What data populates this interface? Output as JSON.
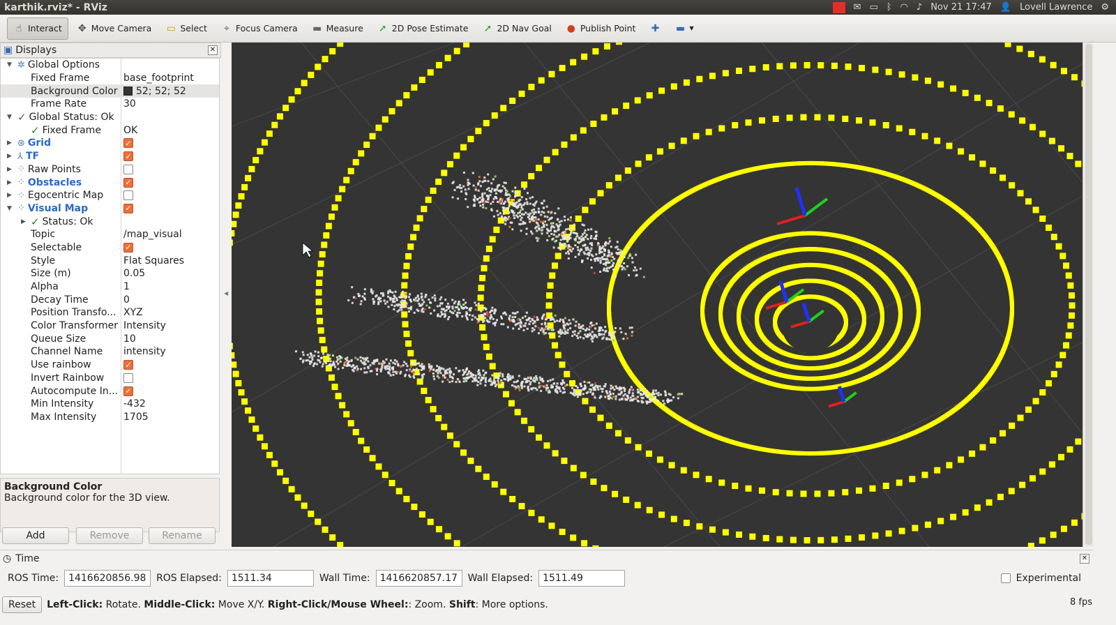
{
  "window": {
    "title": "karthik.rviz* - RViz"
  },
  "tray": {
    "datetime": "Nov 21 17:47",
    "user": "Lovell Lawrence"
  },
  "toolbar": {
    "tools": [
      {
        "label": "Interact",
        "icon": "hand-icon",
        "glyph": "☝",
        "color": "#444444",
        "active": true
      },
      {
        "label": "Move Camera",
        "icon": "move-camera-icon",
        "glyph": "✥",
        "color": "#444444",
        "active": false
      },
      {
        "label": "Select",
        "icon": "select-icon",
        "glyph": "▭",
        "color": "#c8a000",
        "active": false
      },
      {
        "label": "Focus Camera",
        "icon": "focus-camera-icon",
        "glyph": "⌖",
        "color": "#666666",
        "active": false
      },
      {
        "label": "Measure",
        "icon": "ruler-icon",
        "glyph": "▬",
        "color": "#666666",
        "active": false
      },
      {
        "label": "2D Pose Estimate",
        "icon": "pose-arrow-icon",
        "glyph": "➚",
        "color": "#2aa02a",
        "active": false
      },
      {
        "label": "2D Nav Goal",
        "icon": "nav-arrow-icon",
        "glyph": "➚",
        "color": "#2aa02a",
        "active": false
      },
      {
        "label": "Publish Point",
        "icon": "map-pin-icon",
        "glyph": "●",
        "color": "#d04020",
        "active": false
      }
    ]
  },
  "displays": {
    "title": "Displays",
    "rows": [
      {
        "name": "global-options",
        "indent": 0,
        "arrow": "▼",
        "icon": "globe-icon",
        "glyph": "✲",
        "label": "Global Options",
        "style": "",
        "value": "",
        "check": null
      },
      {
        "name": "fixed-frame",
        "indent": 1,
        "label": "Fixed Frame",
        "value": "base_footprint"
      },
      {
        "name": "background-color",
        "indent": 1,
        "label": "Background Color",
        "value": "52; 52; 52",
        "swatch": "#343434",
        "selected": true
      },
      {
        "name": "frame-rate",
        "indent": 1,
        "label": "Frame Rate",
        "value": "30"
      },
      {
        "name": "global-status",
        "indent": 0,
        "arrow": "▼",
        "tickIcon": true,
        "label": "Global Status: Ok",
        "value": ""
      },
      {
        "name": "status-fixed-frame",
        "indent": 1,
        "tickIcon": true,
        "label": "Fixed Frame",
        "value": "OK"
      },
      {
        "name": "grid",
        "indent": 0,
        "arrow": "▶",
        "icon": "grid-icon",
        "glyph": "⊛",
        "label": "Grid",
        "style": "blue",
        "check": true
      },
      {
        "name": "tf",
        "indent": 0,
        "arrow": "▶",
        "icon": "tf-icon",
        "glyph": "⅄",
        "label": "TF",
        "style": "blue",
        "check": true
      },
      {
        "name": "raw-points",
        "indent": 0,
        "arrow": "▶",
        "icon": "pointcloud-icon",
        "glyph": "⁘",
        "label": "Raw Points",
        "style": "",
        "check": false
      },
      {
        "name": "obstacles",
        "indent": 0,
        "arrow": "▶",
        "icon": "pointcloud-icon",
        "glyph": "⁘",
        "label": "Obstacles",
        "style": "blue",
        "check": true
      },
      {
        "name": "egocentric-map",
        "indent": 0,
        "arrow": "▶",
        "icon": "pointcloud-icon",
        "glyph": "⁘",
        "label": "Egocentric Map",
        "style": "",
        "check": false
      },
      {
        "name": "visual-map",
        "indent": 0,
        "arrow": "▼",
        "icon": "pointcloud-icon",
        "glyph": "⁘",
        "label": "Visual Map",
        "style": "blue",
        "check": true
      },
      {
        "name": "visual-map-status",
        "indent": 1,
        "arrow": "▶",
        "tickIcon": true,
        "label": "Status: Ok",
        "value": ""
      },
      {
        "name": "topic",
        "indent": 1,
        "label": "Topic",
        "value": "/map_visual"
      },
      {
        "name": "selectable",
        "indent": 1,
        "label": "Selectable",
        "check": true
      },
      {
        "name": "style",
        "indent": 1,
        "label": "Style",
        "value": "Flat Squares"
      },
      {
        "name": "size",
        "indent": 1,
        "label": "Size (m)",
        "value": "0.05"
      },
      {
        "name": "alpha",
        "indent": 1,
        "label": "Alpha",
        "value": "1"
      },
      {
        "name": "decay-time",
        "indent": 1,
        "label": "Decay Time",
        "value": "0"
      },
      {
        "name": "position-transformer",
        "indent": 1,
        "label": "Position Transfo...",
        "value": "XYZ"
      },
      {
        "name": "color-transformer",
        "indent": 1,
        "label": "Color Transformer",
        "value": "Intensity"
      },
      {
        "name": "queue-size",
        "indent": 1,
        "label": "Queue Size",
        "value": "10"
      },
      {
        "name": "channel-name",
        "indent": 1,
        "label": "Channel Name",
        "value": "intensity"
      },
      {
        "name": "use-rainbow",
        "indent": 1,
        "label": "Use rainbow",
        "check": true
      },
      {
        "name": "invert-rainbow",
        "indent": 1,
        "label": "Invert Rainbow",
        "check": false
      },
      {
        "name": "autocompute-intensity",
        "indent": 1,
        "label": "Autocompute In...",
        "check": true
      },
      {
        "name": "min-intensity",
        "indent": 1,
        "label": "Min Intensity",
        "value": "-432"
      },
      {
        "name": "max-intensity",
        "indent": 1,
        "label": "Max Intensity",
        "value": "1705"
      }
    ],
    "description": {
      "title": "Background Color",
      "text": "Background color for the 3D view."
    },
    "buttons": {
      "add": "Add",
      "remove": "Remove",
      "rename": "Rename"
    }
  },
  "time": {
    "title": "Time",
    "ros_time_label": "ROS Time:",
    "ros_time": "1416620856.98",
    "ros_elapsed_label": "ROS Elapsed:",
    "ros_elapsed": "1511.34",
    "wall_time_label": "Wall Time:",
    "wall_time": "1416620857.17",
    "wall_elapsed_label": "Wall Elapsed:",
    "wall_elapsed": "1511.49",
    "experimental_label": "Experimental"
  },
  "status": {
    "reset": "Reset",
    "hint_left_b": "Left-Click:",
    "hint_left": " Rotate. ",
    "hint_mid_b": "Middle-Click:",
    "hint_mid": " Move X/Y. ",
    "hint_right_b": "Right-Click/Mouse Wheel:",
    "hint_right": ": Zoom. ",
    "hint_shift_b": "Shift",
    "hint_shift": ": More options.",
    "fps": "8 fps"
  },
  "colors": {
    "background": "#343434",
    "points": "#ffff00",
    "accent_check": "#ef6f3a"
  }
}
